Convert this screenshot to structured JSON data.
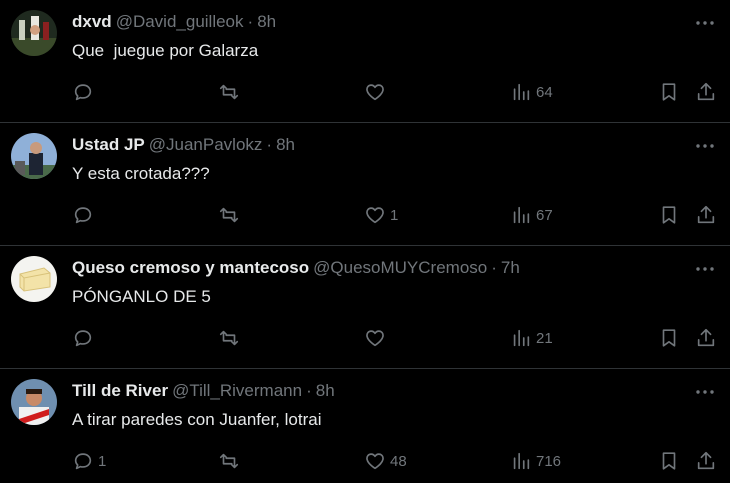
{
  "tweets": [
    {
      "name": "dxvd",
      "handle": "@David_guilleok",
      "separator": "·",
      "time": "8h",
      "text": "Que  juegue por Galarza",
      "replies": "",
      "retweets": "",
      "likes": "",
      "views": "64",
      "avatar_icon": "user-avatar-icon"
    },
    {
      "name": "Ustad JP",
      "handle": "@JuanPavlokz",
      "separator": "·",
      "time": "8h",
      "text": "Y esta crotada???",
      "replies": "",
      "retweets": "",
      "likes": "1",
      "views": "67",
      "avatar_icon": "user-avatar-icon"
    },
    {
      "name": "Queso cremoso y mantecoso",
      "handle": "@QuesoMUYCremoso",
      "separator": "·",
      "time": "7h",
      "text": "PÓNGANLO DE 5",
      "replies": "",
      "retweets": "",
      "likes": "",
      "views": "21",
      "avatar_icon": "cheese-avatar-icon"
    },
    {
      "name": "Till de River",
      "handle": "@Till_Rivermann",
      "separator": "·",
      "time": "8h",
      "text": "A tirar paredes con Juanfer, lotrai",
      "replies": "1",
      "retweets": "",
      "likes": "48",
      "views": "716",
      "avatar_icon": "user-avatar-icon"
    }
  ],
  "colors": {
    "background": "#000000",
    "text": "#e7e9ea",
    "secondary": "#71767b",
    "divider": "#2f3336"
  }
}
